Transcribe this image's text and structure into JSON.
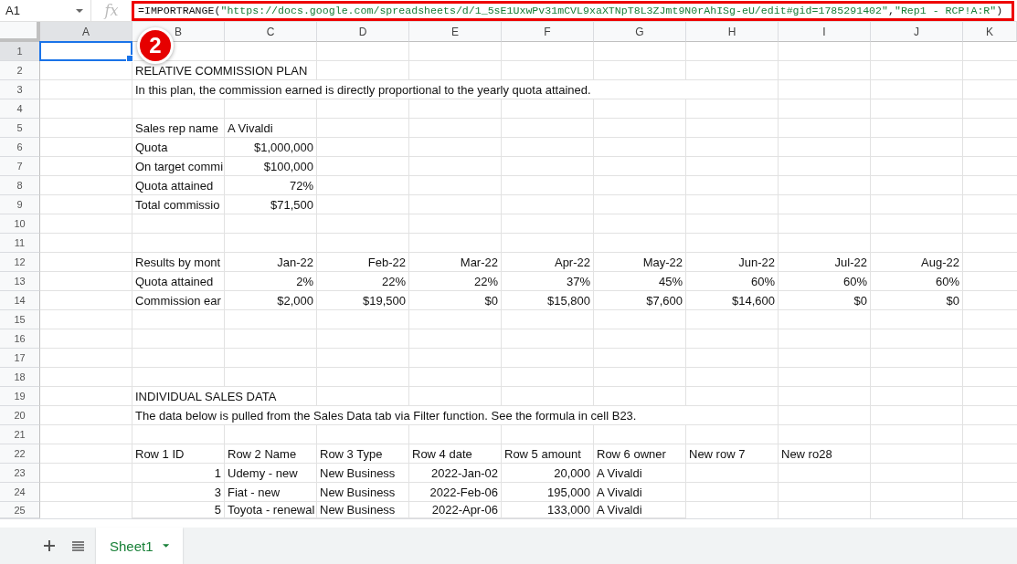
{
  "name_box": "A1",
  "fx_label": "fx",
  "formula": [
    {
      "kind": "plain",
      "text": "=IMPORTRANGE("
    },
    {
      "kind": "string",
      "text": "\"https://docs.google.com/spreadsheets/d/1_5sE1UxwPv31mCVL9xaXTNpT8L3ZJmt9N0rAhISg-eU/edit#gid=1785291402\""
    },
    {
      "kind": "plain",
      "text": ","
    },
    {
      "kind": "string",
      "text": "\"Rep1 - RCP!A:R\""
    },
    {
      "kind": "plain",
      "text": ")"
    }
  ],
  "annotation_badge": "2",
  "columns": [
    {
      "label": "A",
      "selected": true
    },
    {
      "label": "B",
      "selected": false
    },
    {
      "label": "C",
      "selected": false
    },
    {
      "label": "D",
      "selected": false
    },
    {
      "label": "E",
      "selected": false
    },
    {
      "label": "F",
      "selected": false
    },
    {
      "label": "G",
      "selected": false
    },
    {
      "label": "H",
      "selected": false
    },
    {
      "label": "I",
      "selected": false
    },
    {
      "label": "J",
      "selected": false
    },
    {
      "label": "K",
      "selected": false
    }
  ],
  "rows": [
    {
      "number": "1",
      "selected": true,
      "cells": []
    },
    {
      "number": "2",
      "selected": false,
      "cells": [
        null,
        {
          "kind": "text",
          "text": "RELATIVE COMMISSION PLAN"
        }
      ]
    },
    {
      "number": "3",
      "selected": false,
      "cells": [
        null,
        {
          "kind": "text",
          "text": "In this plan, the commission earned is directly proportional to the yearly quota attained."
        }
      ]
    },
    {
      "number": "4",
      "selected": false,
      "cells": []
    },
    {
      "number": "5",
      "selected": false,
      "cells": [
        null,
        {
          "kind": "text",
          "text": "Sales rep name"
        },
        {
          "kind": "text",
          "text": "A Vivaldi"
        }
      ]
    },
    {
      "number": "6",
      "selected": false,
      "cells": [
        null,
        {
          "kind": "text",
          "text": "Quota"
        },
        {
          "kind": "number",
          "text": "$1,000,000"
        }
      ]
    },
    {
      "number": "7",
      "selected": false,
      "cells": [
        null,
        {
          "kind": "text",
          "text": "On target commi"
        },
        {
          "kind": "number",
          "text": "$100,000"
        }
      ]
    },
    {
      "number": "8",
      "selected": false,
      "cells": [
        null,
        {
          "kind": "text",
          "text": "Quota attained"
        },
        {
          "kind": "number",
          "text": "72%"
        }
      ]
    },
    {
      "number": "9",
      "selected": false,
      "cells": [
        null,
        {
          "kind": "text",
          "text": "Total commissio"
        },
        {
          "kind": "number",
          "text": "$71,500"
        }
      ]
    },
    {
      "number": "10",
      "selected": false,
      "cells": []
    },
    {
      "number": "11",
      "selected": false,
      "cells": []
    },
    {
      "number": "12",
      "selected": false,
      "cells": [
        null,
        {
          "kind": "text",
          "text": "Results by mont"
        },
        {
          "kind": "number",
          "text": "Jan-22"
        },
        {
          "kind": "number",
          "text": "Feb-22"
        },
        {
          "kind": "number",
          "text": "Mar-22"
        },
        {
          "kind": "number",
          "text": "Apr-22"
        },
        {
          "kind": "number",
          "text": "May-22"
        },
        {
          "kind": "number",
          "text": "Jun-22"
        },
        {
          "kind": "number",
          "text": "Jul-22"
        },
        {
          "kind": "number",
          "text": "Aug-22"
        }
      ]
    },
    {
      "number": "13",
      "selected": false,
      "cells": [
        null,
        {
          "kind": "text",
          "text": "Quota attained"
        },
        {
          "kind": "number",
          "text": "2%"
        },
        {
          "kind": "number",
          "text": "22%"
        },
        {
          "kind": "number",
          "text": "22%"
        },
        {
          "kind": "number",
          "text": "37%"
        },
        {
          "kind": "number",
          "text": "45%"
        },
        {
          "kind": "number",
          "text": "60%"
        },
        {
          "kind": "number",
          "text": "60%"
        },
        {
          "kind": "number",
          "text": "60%"
        }
      ]
    },
    {
      "number": "14",
      "selected": false,
      "cells": [
        null,
        {
          "kind": "text",
          "text": "Commission ear"
        },
        {
          "kind": "number",
          "text": "$2,000"
        },
        {
          "kind": "number",
          "text": "$19,500"
        },
        {
          "kind": "number",
          "text": "$0"
        },
        {
          "kind": "number",
          "text": "$15,800"
        },
        {
          "kind": "number",
          "text": "$7,600"
        },
        {
          "kind": "number",
          "text": "$14,600"
        },
        {
          "kind": "number",
          "text": "$0"
        },
        {
          "kind": "number",
          "text": "$0"
        }
      ]
    },
    {
      "number": "15",
      "selected": false,
      "cells": []
    },
    {
      "number": "16",
      "selected": false,
      "cells": []
    },
    {
      "number": "17",
      "selected": false,
      "cells": []
    },
    {
      "number": "18",
      "selected": false,
      "cells": []
    },
    {
      "number": "19",
      "selected": false,
      "cells": [
        null,
        {
          "kind": "text",
          "text": "INDIVIDUAL SALES DATA"
        }
      ]
    },
    {
      "number": "20",
      "selected": false,
      "cells": [
        null,
        {
          "kind": "text",
          "text": "The data below is pulled from the Sales Data tab via Filter function. See the formula in cell B23."
        }
      ]
    },
    {
      "number": "21",
      "selected": false,
      "cells": []
    },
    {
      "number": "22",
      "selected": false,
      "cells": [
        null,
        {
          "kind": "text",
          "text": "Row 1 ID"
        },
        {
          "kind": "text",
          "text": "Row 2 Name"
        },
        {
          "kind": "text",
          "text": "Row 3 Type"
        },
        {
          "kind": "text",
          "text": "Row 4 date"
        },
        {
          "kind": "text",
          "text": "Row 5 amount"
        },
        {
          "kind": "text",
          "text": "Row 6 owner"
        },
        {
          "kind": "text",
          "text": "New row 7"
        },
        {
          "kind": "text",
          "text": "New ro28"
        }
      ]
    },
    {
      "number": "23",
      "selected": false,
      "cells": [
        null,
        {
          "kind": "number",
          "text": "1"
        },
        {
          "kind": "text",
          "text": "Udemy -  new"
        },
        {
          "kind": "text",
          "text": "New Business"
        },
        {
          "kind": "number",
          "text": "2022-Jan-02"
        },
        {
          "kind": "number",
          "text": "20,000"
        },
        {
          "kind": "text",
          "text": "A Vivaldi"
        }
      ]
    },
    {
      "number": "24",
      "selected": false,
      "cells": [
        null,
        {
          "kind": "number",
          "text": "3"
        },
        {
          "kind": "text",
          "text": "Fiat - new"
        },
        {
          "kind": "text",
          "text": "New Business"
        },
        {
          "kind": "number",
          "text": "2022-Feb-06"
        },
        {
          "kind": "number",
          "text": "195,000"
        },
        {
          "kind": "text",
          "text": "A Vivaldi"
        }
      ]
    },
    {
      "number": "25",
      "selected": false,
      "cells": [
        null,
        {
          "kind": "number",
          "text": "5"
        },
        {
          "kind": "text",
          "text": "Toyota - renewal"
        },
        {
          "kind": "text",
          "text": "New Business"
        },
        {
          "kind": "number",
          "text": "2022-Apr-06"
        },
        {
          "kind": "number",
          "text": "133,000"
        },
        {
          "kind": "text",
          "text": "A Vivaldi"
        }
      ]
    }
  ],
  "sheet_tabs": [
    {
      "label": "Sheet1",
      "selected": true
    }
  ]
}
